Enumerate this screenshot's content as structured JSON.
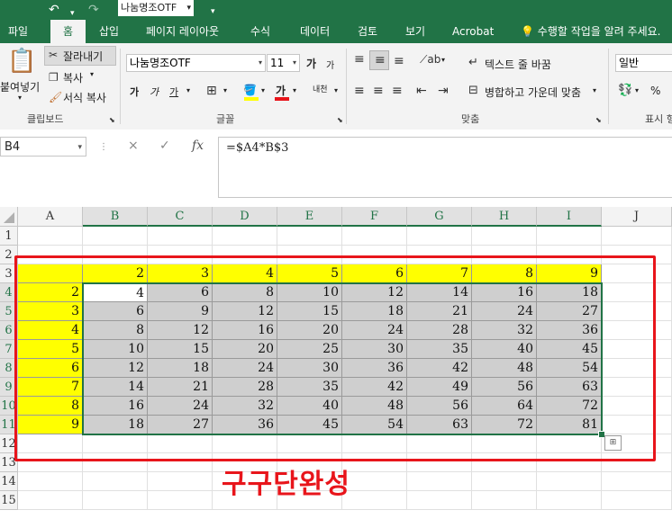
{
  "titlebar": {
    "undo_icon": "undo-icon",
    "redo_icon": "redo-icon",
    "font_name": "나눔명조OTF"
  },
  "tabs": [
    "파일",
    "홈",
    "삽입",
    "페이지 레이아웃",
    "수식",
    "데이터",
    "검토",
    "보기",
    "Acrobat"
  ],
  "active_tab": "홈",
  "tell_me": "수행할 작업을 알려 주세요.",
  "ribbon": {
    "clipboard": {
      "paste": "붙여넣기",
      "cut": "잘라내기",
      "copy": "복사",
      "format_painter": "서식 복사",
      "group_label": "클립보드"
    },
    "font": {
      "font_name": "나눔명조OTF",
      "font_size": "11",
      "grow": "가",
      "shrink": "가",
      "bold": "가",
      "italic": "가",
      "underline": "가",
      "font_color": "가",
      "phonetic": "내천",
      "group_label": "글꼴"
    },
    "alignment": {
      "wrap_text": "텍스트 줄 바꿈",
      "merge_center": "병합하고 가운데 맞춤",
      "group_label": "맞춤"
    },
    "number": {
      "format": "일반",
      "percent": "%",
      "group_label": "표시 형"
    }
  },
  "formula_bar": {
    "name_box": "B4",
    "cancel": "×",
    "enter": "✓",
    "fx": "fx",
    "formula": "=$A4*B$3"
  },
  "columns": [
    "A",
    "B",
    "C",
    "D",
    "E",
    "F",
    "G",
    "H",
    "I",
    "J"
  ],
  "rows": [
    "1",
    "2",
    "3",
    "4",
    "5",
    "6",
    "7",
    "8",
    "9",
    "10",
    "11",
    "12",
    "13",
    "14",
    "15"
  ],
  "sheet": {
    "header_row": [
      "",
      "2",
      "3",
      "4",
      "5",
      "6",
      "7",
      "8",
      "9"
    ],
    "body": [
      [
        "2",
        "4",
        "6",
        "8",
        "10",
        "12",
        "14",
        "16",
        "18"
      ],
      [
        "3",
        "6",
        "9",
        "12",
        "15",
        "18",
        "21",
        "24",
        "27"
      ],
      [
        "4",
        "8",
        "12",
        "16",
        "20",
        "24",
        "28",
        "32",
        "36"
      ],
      [
        "5",
        "10",
        "15",
        "20",
        "25",
        "30",
        "35",
        "40",
        "45"
      ],
      [
        "6",
        "12",
        "18",
        "24",
        "30",
        "36",
        "42",
        "48",
        "54"
      ],
      [
        "7",
        "14",
        "21",
        "28",
        "35",
        "42",
        "49",
        "56",
        "63"
      ],
      [
        "8",
        "16",
        "24",
        "32",
        "40",
        "48",
        "56",
        "64",
        "72"
      ],
      [
        "9",
        "18",
        "27",
        "36",
        "45",
        "54",
        "63",
        "72",
        "81"
      ]
    ]
  },
  "caption": "구구단완성",
  "colors": {
    "excel_green": "#217346",
    "header_yellow": "#ffff00",
    "body_gray": "#cfcfcf",
    "annotation_red": "#e8151b"
  }
}
